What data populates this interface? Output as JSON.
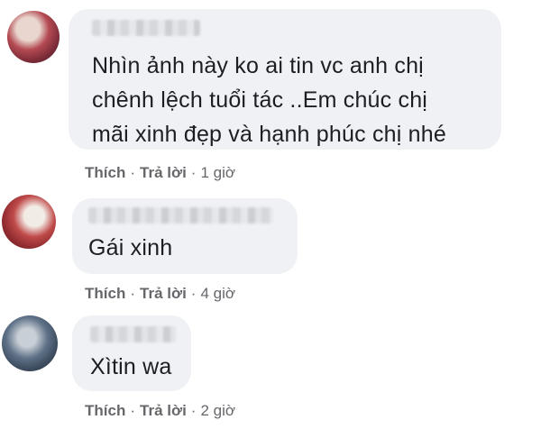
{
  "comments": [
    {
      "text_lines": [
        "Nhìn ảnh này ko ai tin vc anh chị",
        "chênh lệch tuổi tác ..Em chúc chị",
        "mãi xinh đẹp và hạnh phúc chị nhé"
      ],
      "like": "Thích",
      "reply": "Trả lời",
      "time": "1 giờ",
      "sep": "·"
    },
    {
      "text_lines": [
        "Gái xinh"
      ],
      "like": "Thích",
      "reply": "Trả lời",
      "time": "4 giờ",
      "sep": "·"
    },
    {
      "text_lines": [
        "Xìtin wa"
      ],
      "like": "Thích",
      "reply": "Trả lời",
      "time": "2 giờ",
      "sep": "·"
    }
  ],
  "colors": {
    "bubble": "#eff1f4",
    "text": "#1c1e21",
    "meta": "#65676b"
  }
}
